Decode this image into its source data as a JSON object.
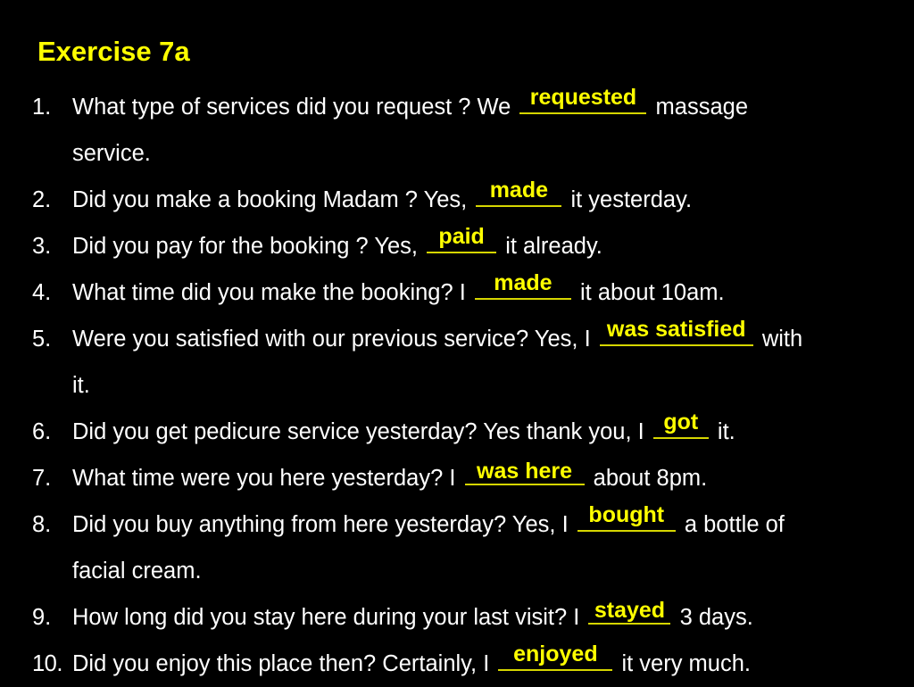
{
  "slide": {
    "title": "Exercise 7a",
    "background_color": "#000000",
    "text_color": "#ffffff",
    "answer_color": "#ffff00",
    "blank_rule_color": "#d6d600"
  },
  "questions": [
    {
      "number": "1.",
      "before": "What type of services did you request ? We",
      "answer": "requested",
      "after": "massage",
      "continuation": "service."
    },
    {
      "number": "2.",
      "before": "Did you make a booking Madam ? Yes,",
      "answer": "made",
      "after": "it yesterday.",
      "continuation": ""
    },
    {
      "number": "3.",
      "before": "Did you pay for the booking ? Yes,",
      "answer": "paid",
      "after": "it already.",
      "continuation": ""
    },
    {
      "number": "4.",
      "before": "What time did you make the booking? I",
      "answer": "made",
      "after": "it about 10am.",
      "continuation": ""
    },
    {
      "number": "5.",
      "before": "Were you satisfied with our previous service? Yes, I",
      "answer": "was satisfied",
      "after": "with",
      "continuation": "it."
    },
    {
      "number": "6.",
      "before": "Did you get pedicure service yesterday? Yes  thank you, I",
      "answer": "got",
      "after": "it.",
      "continuation": ""
    },
    {
      "number": "7.",
      "before": "What time were you here yesterday? I",
      "answer": "was here",
      "after": "about 8pm.",
      "continuation": ""
    },
    {
      "number": "8.",
      "before": "Did you buy anything from here yesterday? Yes, I",
      "answer": "bought",
      "after": "a bottle of",
      "continuation": "facial cream."
    },
    {
      "number": "9.",
      "before": "How long did you stay here during your last visit? I",
      "answer": "stayed",
      "after": "3 days.",
      "continuation": ""
    },
    {
      "number": "10.",
      "before": "Did you enjoy this place then? Certainly, I",
      "answer": "enjoyed",
      "after": "it very much.",
      "continuation": ""
    }
  ]
}
